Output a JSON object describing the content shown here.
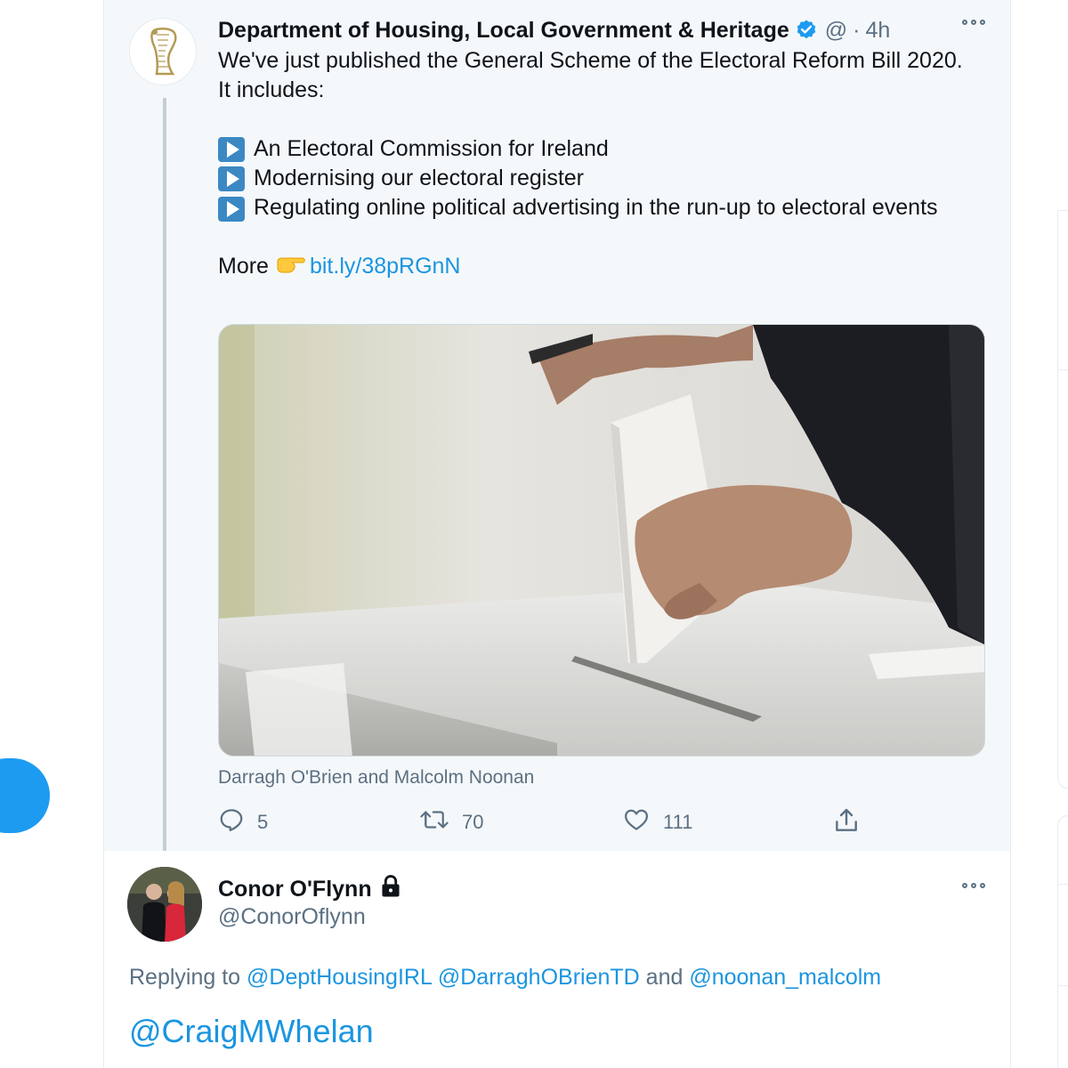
{
  "tweet": {
    "author": {
      "display_name": "Department of Housing, Local Government & Heritage",
      "handle": "@",
      "separator": "·",
      "time": "4h",
      "verified": true,
      "avatar_icon": "harp-emblem-icon"
    },
    "text": {
      "intro": "We've just published the General Scheme of the Electoral Reform Bill 2020. It includes:",
      "bullets": [
        "An Electoral Commission for Ireland",
        "Modernising our electoral register",
        "Regulating online political advertising in the run-up to electoral events"
      ],
      "more_label": "More",
      "link": "bit.ly/38pRGnN"
    },
    "media": {
      "caption": "Darragh O'Brien and Malcolm Noonan"
    },
    "actions": {
      "replies": "5",
      "retweets": "70",
      "likes": "111"
    }
  },
  "reply": {
    "display_name": "Conor O'Flynn",
    "handle": "@ConorOflynn",
    "protected": true,
    "replying_prefix": "Replying to",
    "replying_user_1": "@DeptHousingIRL",
    "replying_user_2": "@DarraghOBrienTD",
    "replying_and": "and",
    "replying_user_3": "@noonan_malcolm",
    "text": "@CraigMWhelan"
  },
  "colors": {
    "accent": "#1b95e0",
    "muted": "#5b7083",
    "verified": "#1d9bf0",
    "thread_bg": "#f5f8fa"
  }
}
